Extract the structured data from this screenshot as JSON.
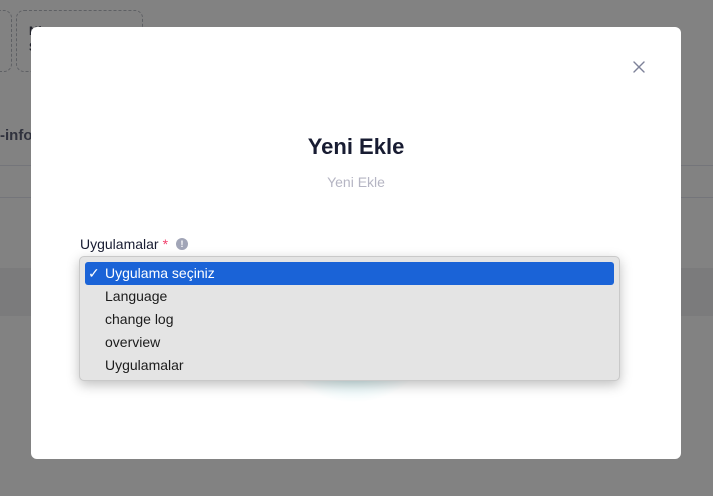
{
  "background": {
    "card_text_line1": "N/",
    "card_text_line2": "S",
    "tab_label": "-info"
  },
  "modal": {
    "title": "Yeni Ekle",
    "subtitle": "Yeni Ekle",
    "close_icon": "close-icon",
    "field": {
      "label": "Uygulamalar",
      "required_mark": "*",
      "info_icon_text": "!"
    },
    "dropdown": {
      "options": [
        {
          "label": "Uygulama seçiniz",
          "selected": true
        },
        {
          "label": "Language",
          "selected": false
        },
        {
          "label": "change log",
          "selected": false
        },
        {
          "label": "overview",
          "selected": false
        },
        {
          "label": "Uygulamalar",
          "selected": false
        }
      ],
      "checkmark": "✓",
      "highlight_color": "#1a63d7"
    }
  }
}
